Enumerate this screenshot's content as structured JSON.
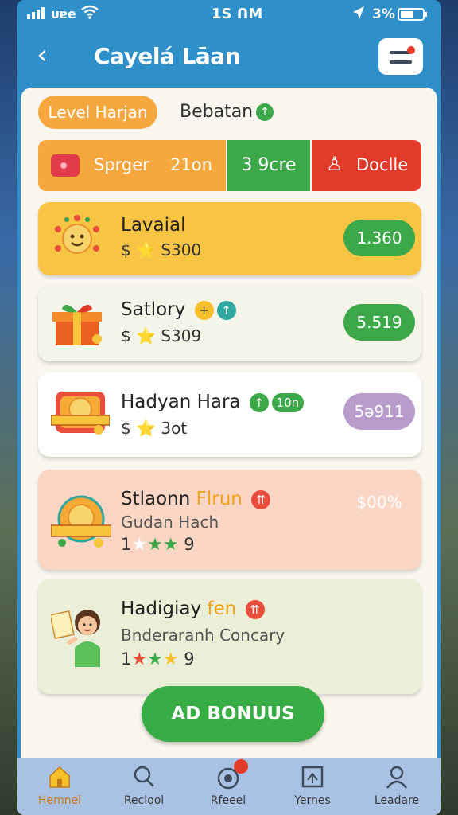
{
  "status": {
    "carrier": "ᴜɐe",
    "time": "1S ᑎM",
    "battery": "3%"
  },
  "header": {
    "title": "Cayelá Lāan"
  },
  "tabs": {
    "level_pill": "Level Harjan",
    "second": "Bebatan",
    "second_badge": "↑"
  },
  "toolbar": {
    "orange_text1": "Sprger",
    "orange_text2": "21on",
    "green_text": "3 9cre",
    "red_text": "Doclle"
  },
  "cards": [
    {
      "name": "Lavaial",
      "sub": "$ ⭐ S300",
      "price": "1.360",
      "price_color": "#3ca84a",
      "bg": "#f8c444"
    },
    {
      "name": "Satlory",
      "badge1": "+",
      "badge2": "↑",
      "sub": "$ ⭐ S309",
      "price": "5.519",
      "price_color": "#3ca84a",
      "bg": "#f5f4e8"
    },
    {
      "name": "Hadyan Hara",
      "badge1": "↑",
      "badge2": "10n",
      "sub": "$ ⭐ 3ot",
      "price": "5ə911",
      "price_color": "#b89ccc",
      "bg": "#ffffff"
    },
    {
      "name_a": "Stlaonn ",
      "name_b": "Flrun",
      "badge1": "⇈",
      "sub": "Gudan Hach",
      "rating_lead": "1",
      "rating": "9",
      "price": "$00%",
      "bg": "#fbd6c4"
    },
    {
      "name_a": "Hadigiay ",
      "name_b": "fen",
      "badge1": "⇈",
      "sub": "Bnderaranh Concary",
      "rating_lead": "1",
      "rating": "9",
      "bg": "#ecefd8"
    }
  ],
  "ad_button": "AD BONUUS",
  "nav": [
    "Hemnel",
    "Reclool",
    "Rfeeel",
    "Yernes",
    "Leadare"
  ],
  "colors": {
    "accent": "#2e8fc9",
    "green": "#3ca84a",
    "orange": "#f6a83e",
    "red": "#e23b2b"
  }
}
